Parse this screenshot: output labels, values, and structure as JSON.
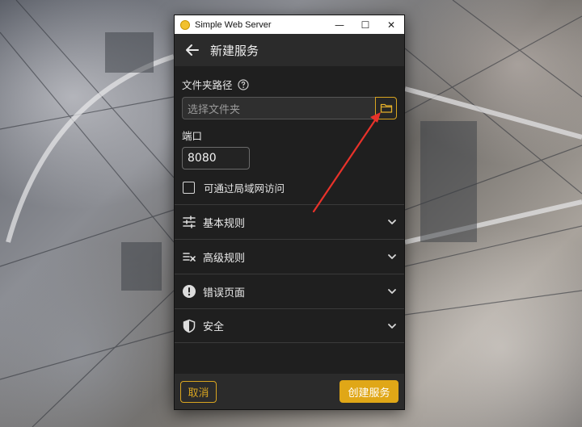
{
  "window": {
    "app_title": "Simple Web Server",
    "controls": {
      "minimize": "—",
      "maximize": "☐",
      "close": "✕"
    }
  },
  "header": {
    "title": "新建服务"
  },
  "folder": {
    "label": "文件夹路径",
    "placeholder": "选择文件夹"
  },
  "port": {
    "label": "端口",
    "value": "8080"
  },
  "lan_access": {
    "label": "可通过局域网访问",
    "checked": false
  },
  "sections": [
    {
      "label": "基本规则",
      "icon": "sliders-icon"
    },
    {
      "label": "高级规则",
      "icon": "rules-icon"
    },
    {
      "label": "错误页面",
      "icon": "alert-icon"
    },
    {
      "label": "安全",
      "icon": "shield-icon"
    }
  ],
  "footer": {
    "cancel_label": "取消",
    "create_label": "创建服务"
  },
  "colors": {
    "accent": "#d9a520",
    "create_bg": "#e0a717",
    "arrow": "#e8322a"
  }
}
